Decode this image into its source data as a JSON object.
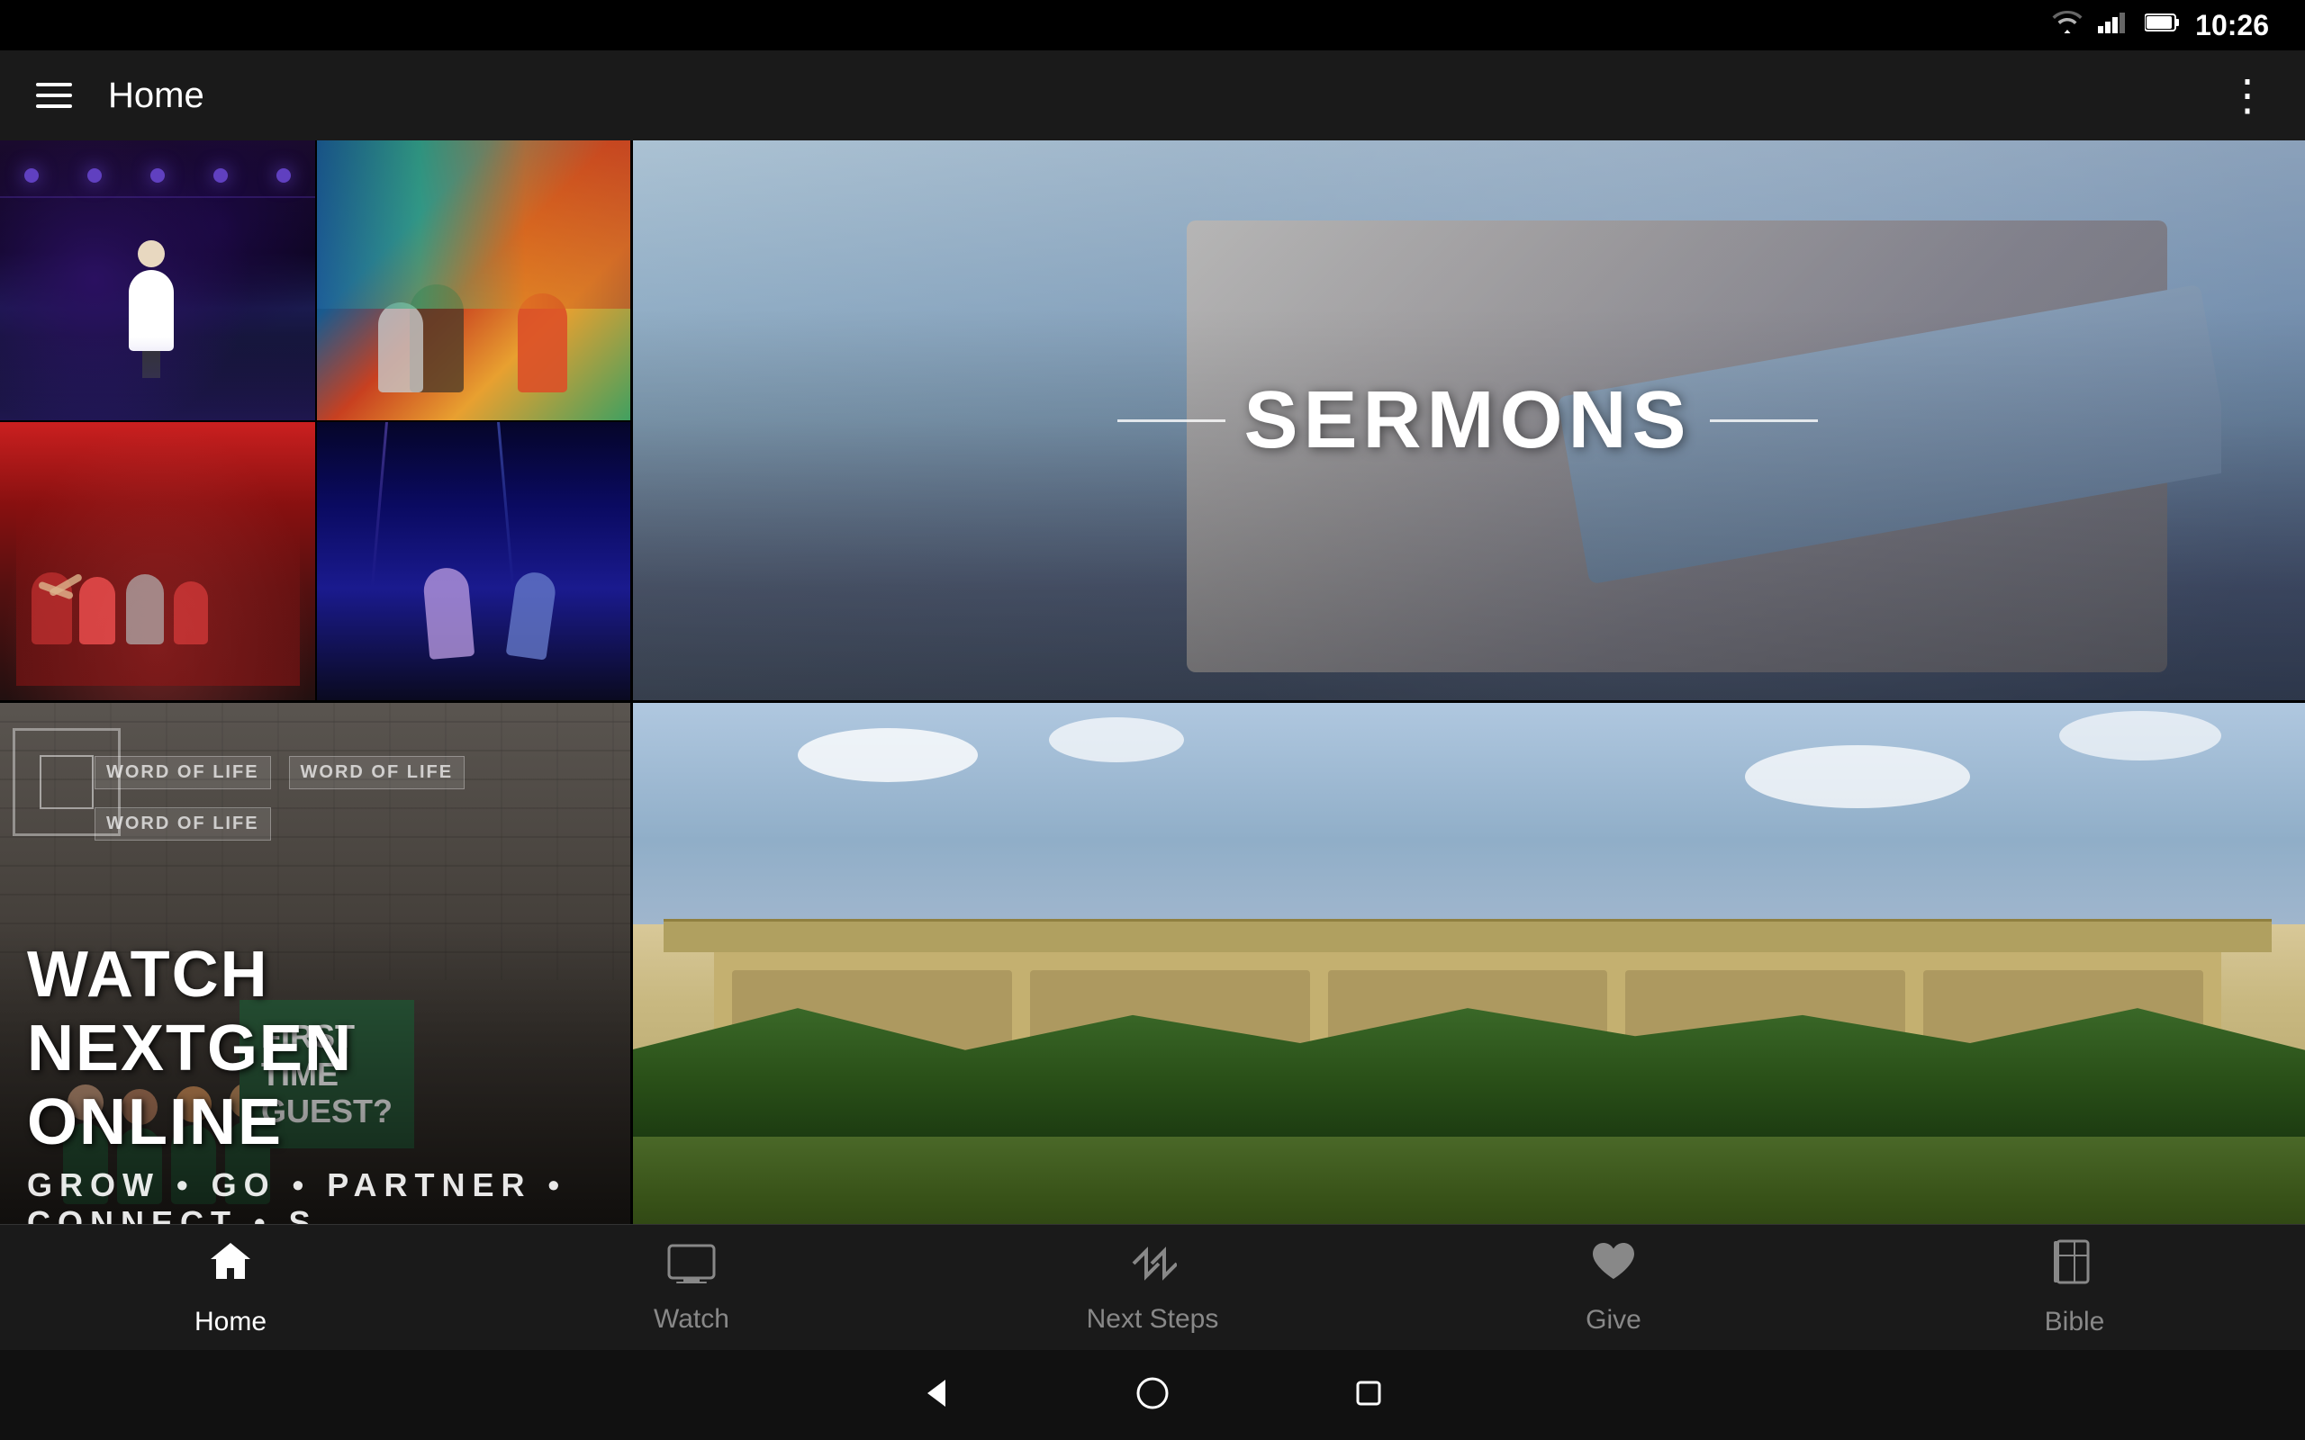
{
  "statusBar": {
    "time": "10:26",
    "wifiIcon": "wifi",
    "signalIcon": "signal",
    "batteryIcon": "battery"
  },
  "appBar": {
    "menuIcon": "menu",
    "title": "Home",
    "moreIcon": "more-vertical"
  },
  "contentPanels": {
    "panel1Label": "speaker-image",
    "panel2Label": "performers-image",
    "panel3Label": "kids-crowd-image",
    "panel4Label": "dance-image",
    "watchNextgenText": "WATCH NEXTGEN ONLINE",
    "growGoText": "GROW • GO • PARTNER • CONNECT • S",
    "sermonsText": "SERMONS",
    "firstTimeText": "FIRST\nTIME\nGUEST?",
    "wordOfLife": "WORD OF LIFE",
    "buildingLabel": "building-exterior"
  },
  "bottomNav": {
    "items": [
      {
        "id": "home",
        "label": "Home",
        "icon": "home",
        "active": true
      },
      {
        "id": "watch",
        "label": "Watch",
        "icon": "monitor",
        "active": false
      },
      {
        "id": "nextsteps",
        "label": "Next Steps",
        "icon": "chevrons-right",
        "active": false
      },
      {
        "id": "give",
        "label": "Give",
        "icon": "heart",
        "active": false
      },
      {
        "id": "bible",
        "label": "Bible",
        "icon": "book-open",
        "active": false
      }
    ]
  },
  "systemNav": {
    "backIcon": "triangle-left",
    "homeIcon": "circle",
    "recentIcon": "square"
  }
}
